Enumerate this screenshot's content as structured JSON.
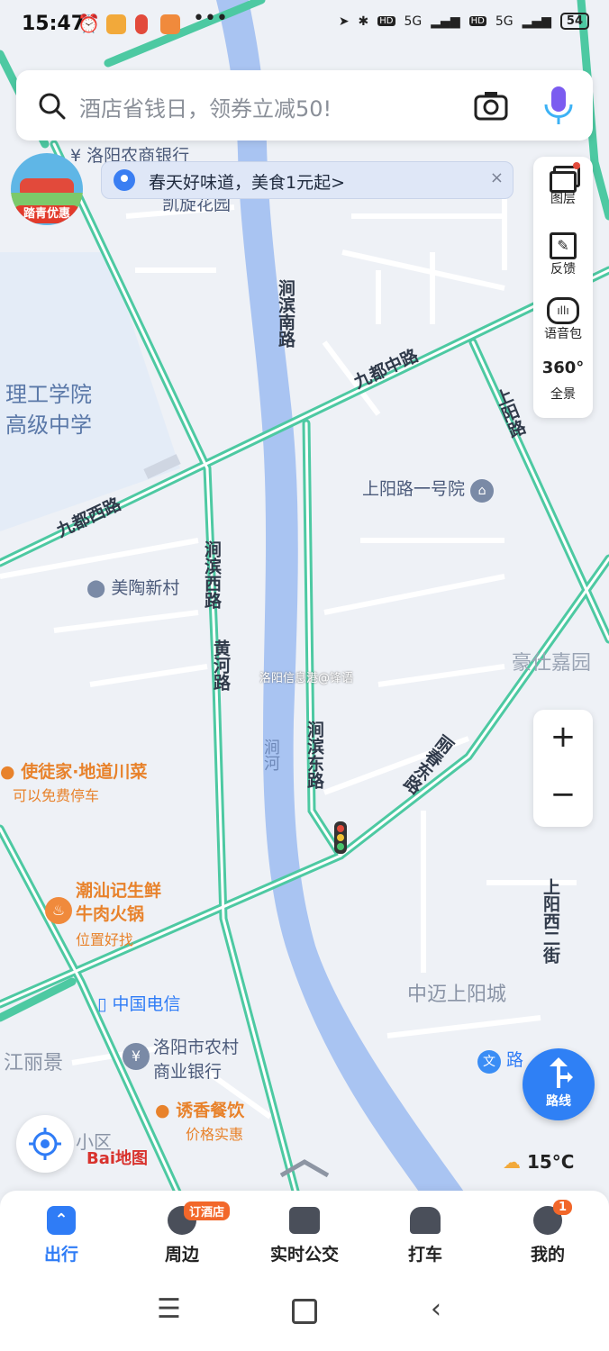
{
  "status_bar": {
    "time": "15:47",
    "dots": "•••",
    "signal1": "5G",
    "signal2": "5G",
    "hd1": "HD",
    "hd2": "HD",
    "battery": "54"
  },
  "search": {
    "placeholder": "酒店省钱日，领券立减50!"
  },
  "notice": {
    "text": "春天好味道，美食1元起>",
    "close": "×"
  },
  "promo": {
    "label": "踏青优惠"
  },
  "tools": {
    "layers": "图层",
    "feedback": "反馈",
    "voice": "语音包",
    "panorama_num": "360°",
    "panorama": "全景"
  },
  "zoom": {
    "plus": "+",
    "minus": "−"
  },
  "route_button": {
    "label": "路线"
  },
  "weather": {
    "temp": "15°C"
  },
  "brand": {
    "logo": "Bai地图"
  },
  "watermark": "洛阳信息港@锋语",
  "map_labels": {
    "bank_top": "洛阳农商银行",
    "kaixuan": "凯旋花园",
    "jianbin_nan": "涧滨南路",
    "ligong": "理工学院",
    "gaoji": "高级中学",
    "jiudu_zhong": "九都中路",
    "jiudu_xi": "九都西路",
    "shangyang_lu": "上阳路",
    "shangyang_yihao": "上阳路一号院",
    "meitao": "美陶新村",
    "jianbin_xi": "涧滨西路",
    "huanghe": "黄河路",
    "haoshi": "豪仕嘉园",
    "jianhe": "涧河",
    "jianbin_dong": "涧滨东路",
    "lichun_dong": "丽春东路",
    "shitujia": "使徒家·地道川菜",
    "shitujia_sub": "可以免费停车",
    "chaoshan1": "潮汕记生鲜",
    "chaoshan2": "牛肉火锅",
    "chaoshan_sub": "位置好找",
    "shangyang_xi2": "上阳西二街",
    "zhongmai": "中迈上阳城",
    "telecom": "中国电信",
    "jiangli": "江丽景",
    "nongcun1": "洛阳市农村",
    "nongcun2": "商业银行",
    "wenlu": "路",
    "youxiang": "诱香餐饮",
    "youxiang_sub": "价格实惠",
    "xiaoqu": "小区"
  },
  "bottom_nav": [
    {
      "label": "出行"
    },
    {
      "label": "周边",
      "badge": "订酒店"
    },
    {
      "label": "实时公交"
    },
    {
      "label": "打车"
    },
    {
      "label": "我的",
      "badge": "1"
    }
  ],
  "colors": {
    "accent": "#2f7cf6",
    "road": "#4dc9a2",
    "river": "#a9c4f2",
    "poi_orange": "#e8822b"
  }
}
